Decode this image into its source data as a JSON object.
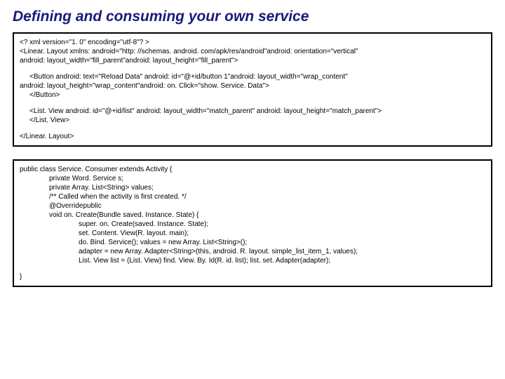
{
  "title": "Defining and consuming your own service",
  "xml": {
    "line1": "<? xml version=\"1. 0\" encoding=\"utf-8\"? >",
    "line2": "<Linear. Layout xmlns: android=\"http: //schemas. android. com/apk/res/android\"android: orientation=\"vertical\"",
    "line3": "android: layout_width=\"fill_parent\"android: layout_height=\"fill_parent\">",
    "line4": "<Button android: text=\"Reload Data\" android: id=\"@+id/button 1\"android: layout_width=\"wrap_content\"",
    "line5": "android: layout_height=\"wrap_content\"android: on. Click=\"show. Service. Data\">",
    "line6": "</Button>",
    "line7": "<List. View android: id=\"@+id/list\" android: layout_width=\"match_parent\" android: layout_height=\"match_parent\">",
    "line8": "</List. View>",
    "line9": "</Linear. Layout>"
  },
  "java": {
    "line1": "public class Service. Consumer extends Activity {",
    "line2": "private Word. Service s;",
    "line3": "private Array. List<String> values;",
    "line4": "/** Called when the activity is first created. */",
    "line5": "@Overridepublic",
    "line6": "void on. Create(Bundle saved. Instance. State) {",
    "line7": "super. on. Create(saved. Instance. State);",
    "line8": "set. Content. View(R. layout. main);",
    "line9": "do. Bind. Service(); values = new Array. List<String>();",
    "line10": "adapter = new Array. Adapter<String>(this, android. R. layout. simple_list_item_1, values);",
    "line11": "List. View list = (List. View) find. View. By. Id(R. id. list); list. set. Adapter(adapter);",
    "line12": "}"
  }
}
